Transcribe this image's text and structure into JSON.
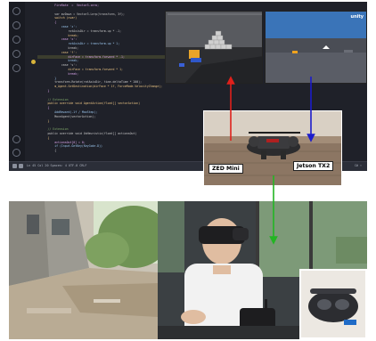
{
  "ide": {
    "code_lines": [
      "          FireRate  =  Vector3.zero;",
      "",
      "          var mvDown = Vector3.Lerp(transform, 3f);",
      "          switch (nvar)",
      "          {",
      "              case 'z':",
      "                  rotAxisDir = transform.up * -1;",
      "                  break;",
      "              case 'x':",
      "                  rotAxisDir = transform.up * 1;",
      "                  break;",
      "              case 'f':",
      "                  dirFace = transform.forward * -1;",
      "                  break;",
      "              case 's':",
      "                  dirFace = transform.forward * 1;",
      "                  break;",
      "          }",
      "          transform.Rotate(rotAxisDir, time.deltaTime * 200);",
      "          m_Agent.SetDestination(dirFace * 1f, ForceMode.VelocityChange);",
      "      }",
      "",
      "      // Extension",
      "      public override void AgentAction(float[] vectorAction)",
      "      {",
      "          AddReward(-1f / MaxStep);",
      "          MoveAgent(vectorAction);",
      "      }",
      "",
      "      // Extension",
      "      public override void OnHeuristic(float[] actionsOut)",
      "      {",
      "          actionsOut[0] = 0;",
      "          if (Input.GetKey(KeyCode.D))",
      "          {"
    ],
    "status_left": "Ln 45  Col 20  Spaces: 4  UTF-8  CRLF",
    "status_right": "C#  ⚡"
  },
  "unity": {
    "logo_text": "unity"
  },
  "labels": {
    "zed": "ZED Mini",
    "jetson": "Jetson TX2"
  },
  "colors": {
    "red_arrow": "#e0201b",
    "blue_arrow": "#1c1ccc",
    "green_arrow": "#23b523"
  }
}
